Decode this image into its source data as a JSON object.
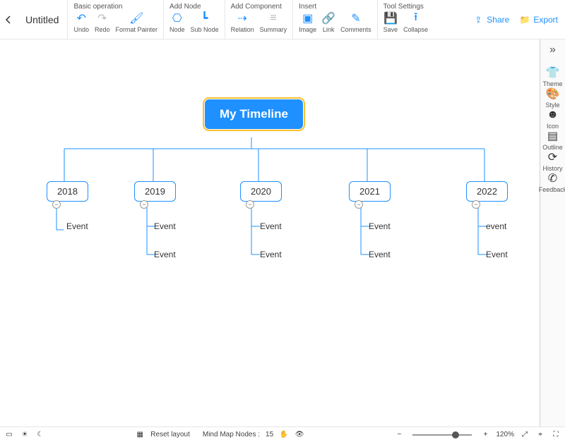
{
  "header": {
    "title": "Untitled"
  },
  "toolbar": {
    "groups": [
      {
        "title": "Basic operation",
        "items": [
          {
            "name": "undo-button",
            "label": "Undo",
            "glyph": "↶",
            "dis": false
          },
          {
            "name": "redo-button",
            "label": "Redo",
            "glyph": "↷",
            "dis": true
          },
          {
            "name": "format-painter-button",
            "label": "Format Painter",
            "glyph": "🖌",
            "dis": false
          }
        ]
      },
      {
        "title": "Add Node",
        "items": [
          {
            "name": "add-node-button",
            "label": "Node",
            "glyph": "⎔",
            "dis": false
          },
          {
            "name": "add-subnode-button",
            "label": "Sub Node",
            "glyph": "┗",
            "dis": false
          }
        ]
      },
      {
        "title": "Add Component",
        "items": [
          {
            "name": "relation-button",
            "label": "Relation",
            "glyph": "⇢",
            "dis": false
          },
          {
            "name": "summary-button",
            "label": "Summary",
            "glyph": "≡",
            "dis": true
          }
        ]
      },
      {
        "title": "Insert",
        "items": [
          {
            "name": "image-button",
            "label": "Image",
            "glyph": "▣",
            "dis": false
          },
          {
            "name": "link-button",
            "label": "Link",
            "glyph": "🔗",
            "dis": false
          },
          {
            "name": "comments-button",
            "label": "Comments",
            "glyph": "✎",
            "dis": false
          }
        ]
      },
      {
        "title": "Tool Settings",
        "items": [
          {
            "name": "save-button",
            "label": "Save",
            "glyph": "💾",
            "dis": false
          },
          {
            "name": "collapse-button",
            "label": "Collapse",
            "glyph": "⭱",
            "dis": false
          }
        ]
      }
    ],
    "share": "Share",
    "export": "Export"
  },
  "sidepanel": [
    {
      "name": "theme-button",
      "label": "Theme",
      "glyph": "👕"
    },
    {
      "name": "style-button",
      "label": "Style",
      "glyph": "🎨"
    },
    {
      "name": "icon-button",
      "label": "Icon",
      "glyph": "☻"
    },
    {
      "name": "outline-button",
      "label": "Outline",
      "glyph": "▤"
    },
    {
      "name": "history-button",
      "label": "History",
      "glyph": "⟳"
    },
    {
      "name": "feedback-button",
      "label": "Feedback",
      "glyph": "✆"
    }
  ],
  "mindmap": {
    "root": "My Timeline",
    "branches": [
      {
        "year": "2018",
        "children": [
          "Event"
        ]
      },
      {
        "year": "2019",
        "children": [
          "Event",
          "Event"
        ]
      },
      {
        "year": "2020",
        "children": [
          "Event",
          "Event"
        ]
      },
      {
        "year": "2021",
        "children": [
          "Event",
          "Event"
        ]
      },
      {
        "year": "2022",
        "children": [
          "event",
          "Event"
        ]
      }
    ]
  },
  "bottombar": {
    "reset": "Reset layout",
    "nodes_label": "Mind Map Nodes :",
    "nodes_count": "15",
    "zoom": "120%"
  }
}
